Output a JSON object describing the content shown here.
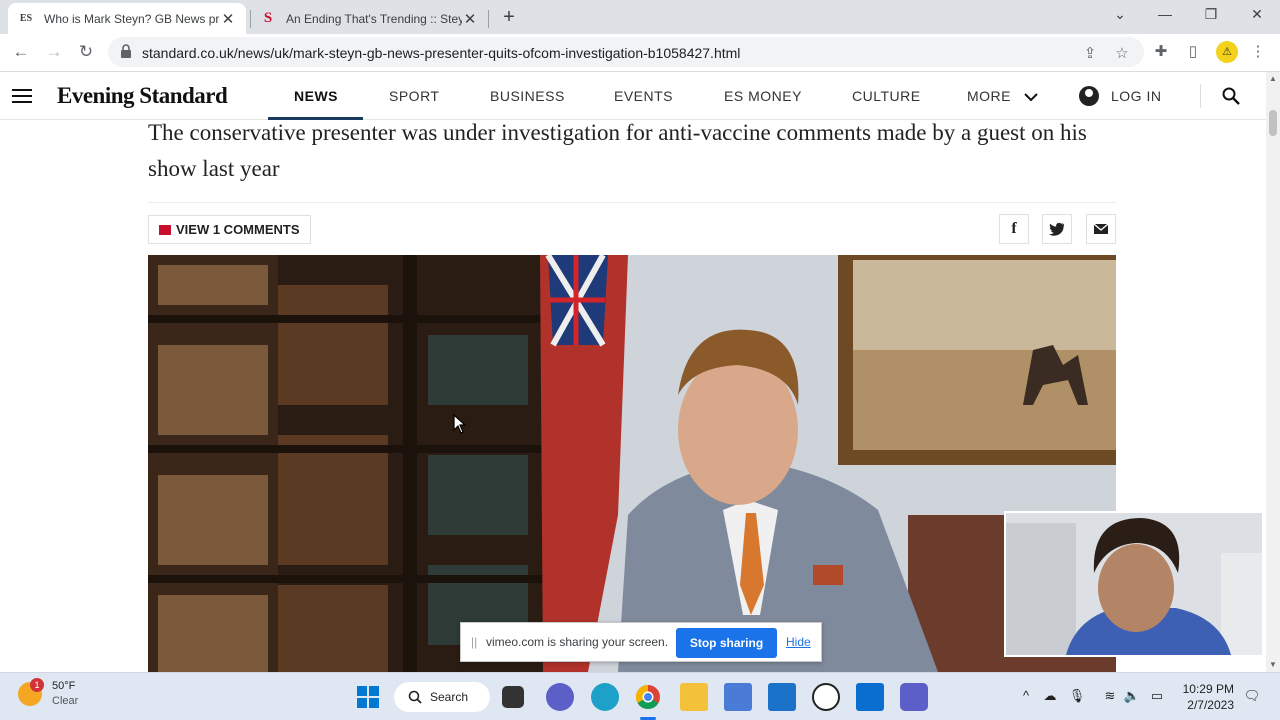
{
  "browser": {
    "tabs": [
      {
        "favicon": "ES",
        "title": "Who is Mark Steyn? GB News pre",
        "active": true
      },
      {
        "favicon": "S",
        "title": "An Ending That's Trending :: Stey",
        "active": false
      }
    ],
    "url": "standard.co.uk/news/uk/mark-steyn-gb-news-presenter-quits-ofcom-investigation-b1058427.html"
  },
  "site": {
    "logo": "Evening Standard",
    "nav": [
      "NEWS",
      "SPORT",
      "BUSINESS",
      "EVENTS",
      "ES MONEY",
      "CULTURE",
      "MORE"
    ],
    "login": "LOG IN"
  },
  "article": {
    "standfirst": "The conservative presenter was under investigation for anti-vaccine comments made by a guest on his show last year",
    "comments_label": "VIEW 1 COMMENTS",
    "share": [
      "facebook-icon",
      "twitter-icon",
      "email-icon"
    ]
  },
  "sharing_bar": {
    "message": "vimeo.com is sharing your screen.",
    "stop_label": "Stop sharing",
    "hide_label": "Hide"
  },
  "taskbar": {
    "weather_temp": "50°F",
    "weather_desc": "Clear",
    "weather_badge": "1",
    "search_label": "Search",
    "time": "10:29 PM",
    "date": "2/7/2023"
  },
  "colors": {
    "brand_red": "#c8102e",
    "nav_underline": "#1a3b5d",
    "share_blue": "#1a73e8"
  }
}
